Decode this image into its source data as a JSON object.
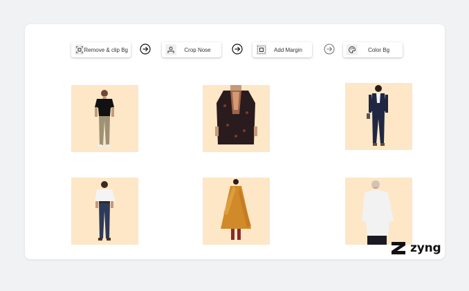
{
  "pipeline": {
    "steps": [
      {
        "label": "Remove & clip Bg",
        "icon": "frame-focus-icon"
      },
      {
        "label": "Crop Nose",
        "icon": "person-crop-icon"
      },
      {
        "label": "Add Margin",
        "icon": "margin-grid-icon"
      },
      {
        "label": "Color Bg",
        "icon": "palette-icon"
      }
    ],
    "arrow_icon": "arrow-right-circle-icon"
  },
  "gallery": {
    "background_color": "#fde7c7",
    "items": [
      {
        "subject": "man-black-tshirt-khaki-pants"
      },
      {
        "subject": "woman-black-embroidered-kurta"
      },
      {
        "subject": "woman-navy-blazer-suit"
      },
      {
        "subject": "man-white-shirt-navy-trousers"
      },
      {
        "subject": "woman-mustard-anarkali-dupatta"
      },
      {
        "subject": "man-white-hoodie"
      }
    ]
  },
  "brand": {
    "name": "zyng"
  }
}
